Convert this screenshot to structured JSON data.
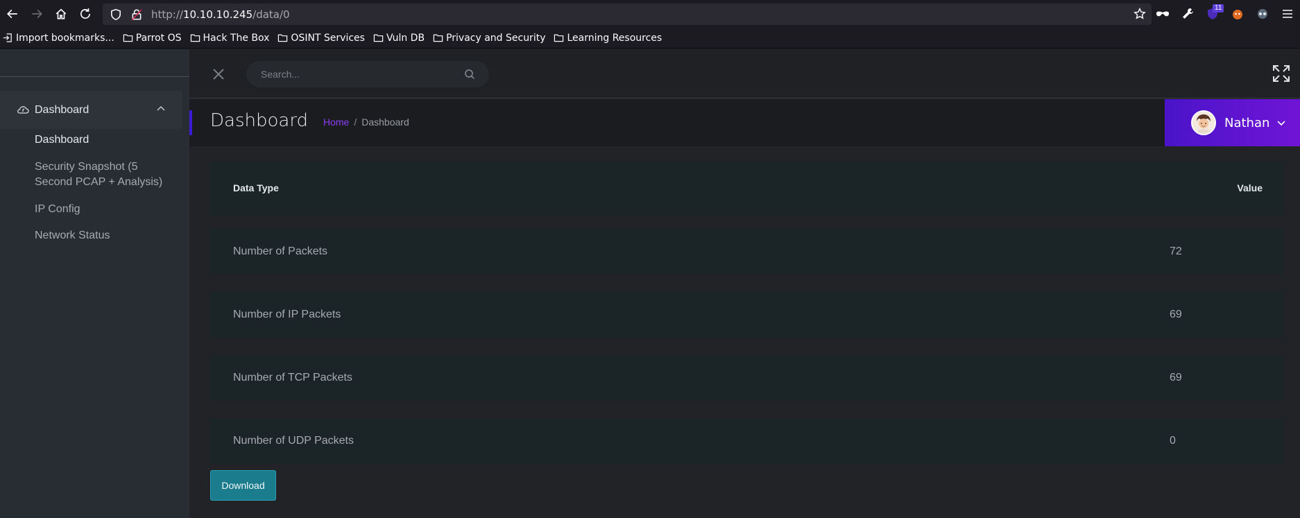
{
  "browser": {
    "url_prefix": "http://",
    "url_host": "10.10.10.245",
    "url_path": "/data/0",
    "extension_badge": "11",
    "bookmarks": [
      {
        "label": "Import bookmarks...",
        "icon": "import-icon"
      },
      {
        "label": "Parrot OS",
        "icon": "folder-icon"
      },
      {
        "label": "Hack The Box",
        "icon": "folder-icon"
      },
      {
        "label": "OSINT Services",
        "icon": "folder-icon"
      },
      {
        "label": "Vuln DB",
        "icon": "folder-icon"
      },
      {
        "label": "Privacy and Security",
        "icon": "folder-icon"
      },
      {
        "label": "Learning Resources",
        "icon": "folder-icon"
      }
    ]
  },
  "sidebar": {
    "section_label": "Dashboard",
    "items": [
      {
        "label": "Dashboard"
      },
      {
        "label": "Security Snapshot (5 Second PCAP + Analysis)"
      },
      {
        "label": "IP Config"
      },
      {
        "label": "Network Status"
      }
    ]
  },
  "topbar": {
    "search_placeholder": "Search..."
  },
  "header": {
    "title": "Dashboard",
    "breadcrumb_home": "Home",
    "breadcrumb_sep": "/",
    "breadcrumb_current": "Dashboard",
    "user_name": "Nathan"
  },
  "table": {
    "col_type": "Data Type",
    "col_value": "Value",
    "rows": [
      {
        "name": "Number of Packets",
        "value": "72"
      },
      {
        "name": "Number of IP Packets",
        "value": "69"
      },
      {
        "name": "Number of TCP Packets",
        "value": "69"
      },
      {
        "name": "Number of UDP Packets",
        "value": "0"
      }
    ]
  },
  "actions": {
    "download_label": "Download"
  },
  "colors": {
    "accent_purple": "#8c3df2",
    "download_teal": "#1b7c8d"
  }
}
